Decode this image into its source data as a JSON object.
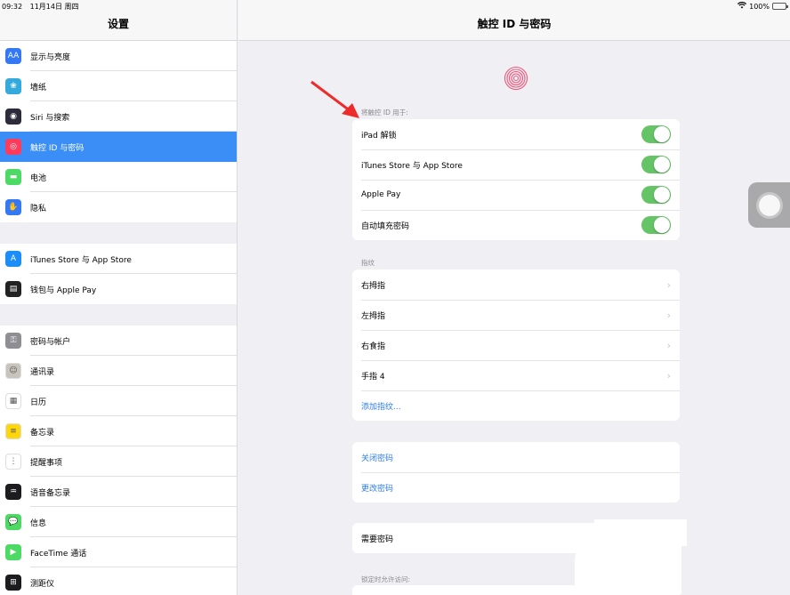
{
  "status": {
    "time": "09:32",
    "date": "11月14日 周四",
    "battery": "100%"
  },
  "sidebar": {
    "title": "设置",
    "groups": [
      [
        {
          "label": "显示与亮度",
          "icon": "display-icon",
          "color": "#3478f6",
          "glyph": "AA"
        },
        {
          "label": "墙纸",
          "icon": "wallpaper-icon",
          "color": "#34aadc",
          "glyph": "❀"
        },
        {
          "label": "Siri 与搜索",
          "icon": "siri-icon",
          "color": "#2b2b3a",
          "glyph": "◉"
        },
        {
          "label": "触控 ID 与密码",
          "icon": "fingerprint-icon",
          "color": "#ff3b5c",
          "glyph": "◎"
        },
        {
          "label": "电池",
          "icon": "battery-icon",
          "color": "#4cd964",
          "glyph": "▬"
        },
        {
          "label": "隐私",
          "icon": "privacy-hand-icon",
          "color": "#3478f6",
          "glyph": "✋"
        }
      ],
      [
        {
          "label": "iTunes Store 与 App Store",
          "icon": "appstore-icon",
          "color": "#1c8ef9",
          "glyph": "A"
        },
        {
          "label": "钱包与 Apple Pay",
          "icon": "wallet-icon",
          "color": "#222222",
          "glyph": "▤"
        }
      ],
      [
        {
          "label": "密码与帐户",
          "icon": "key-icon",
          "color": "#8e8e93",
          "glyph": "⚿"
        },
        {
          "label": "通讯录",
          "icon": "contacts-icon",
          "color": "#c8c4bc",
          "glyph": "☺"
        },
        {
          "label": "日历",
          "icon": "calendar-icon",
          "color": "#ffffff",
          "glyph": "▦"
        },
        {
          "label": "备忘录",
          "icon": "notes-icon",
          "color": "#ffd60a",
          "glyph": "≡"
        },
        {
          "label": "提醒事项",
          "icon": "reminders-icon",
          "color": "#ffffff",
          "glyph": "⋮"
        },
        {
          "label": "语音备忘录",
          "icon": "voice-memo-icon",
          "color": "#1c1c1e",
          "glyph": "♒"
        },
        {
          "label": "信息",
          "icon": "messages-icon",
          "color": "#4cd964",
          "glyph": "💬"
        },
        {
          "label": "FaceTime 通话",
          "icon": "facetime-icon",
          "color": "#4cd964",
          "glyph": "▶"
        },
        {
          "label": "测距仪",
          "icon": "measure-icon",
          "color": "#1c1c1e",
          "glyph": "⊞"
        }
      ]
    ]
  },
  "main": {
    "title": "触控 ID 与密码",
    "use_for_label": "将触控 ID 用于:",
    "toggles": [
      {
        "label": "iPad 解锁",
        "on": true
      },
      {
        "label": "iTunes Store 与 App Store",
        "on": true
      },
      {
        "label": "Apple Pay",
        "on": true
      },
      {
        "label": "自动填充密码",
        "on": true
      }
    ],
    "fingerprints_label": "指纹",
    "fingerprints": [
      "右拇指",
      "左拇指",
      "右食指",
      "手指 4"
    ],
    "add_fingerprint": "添加指纹...",
    "passcode_links": [
      "关闭密码",
      "更改密码"
    ],
    "require_passcode": "需要密码",
    "locked_access_label": "锁定时允许访问:"
  }
}
